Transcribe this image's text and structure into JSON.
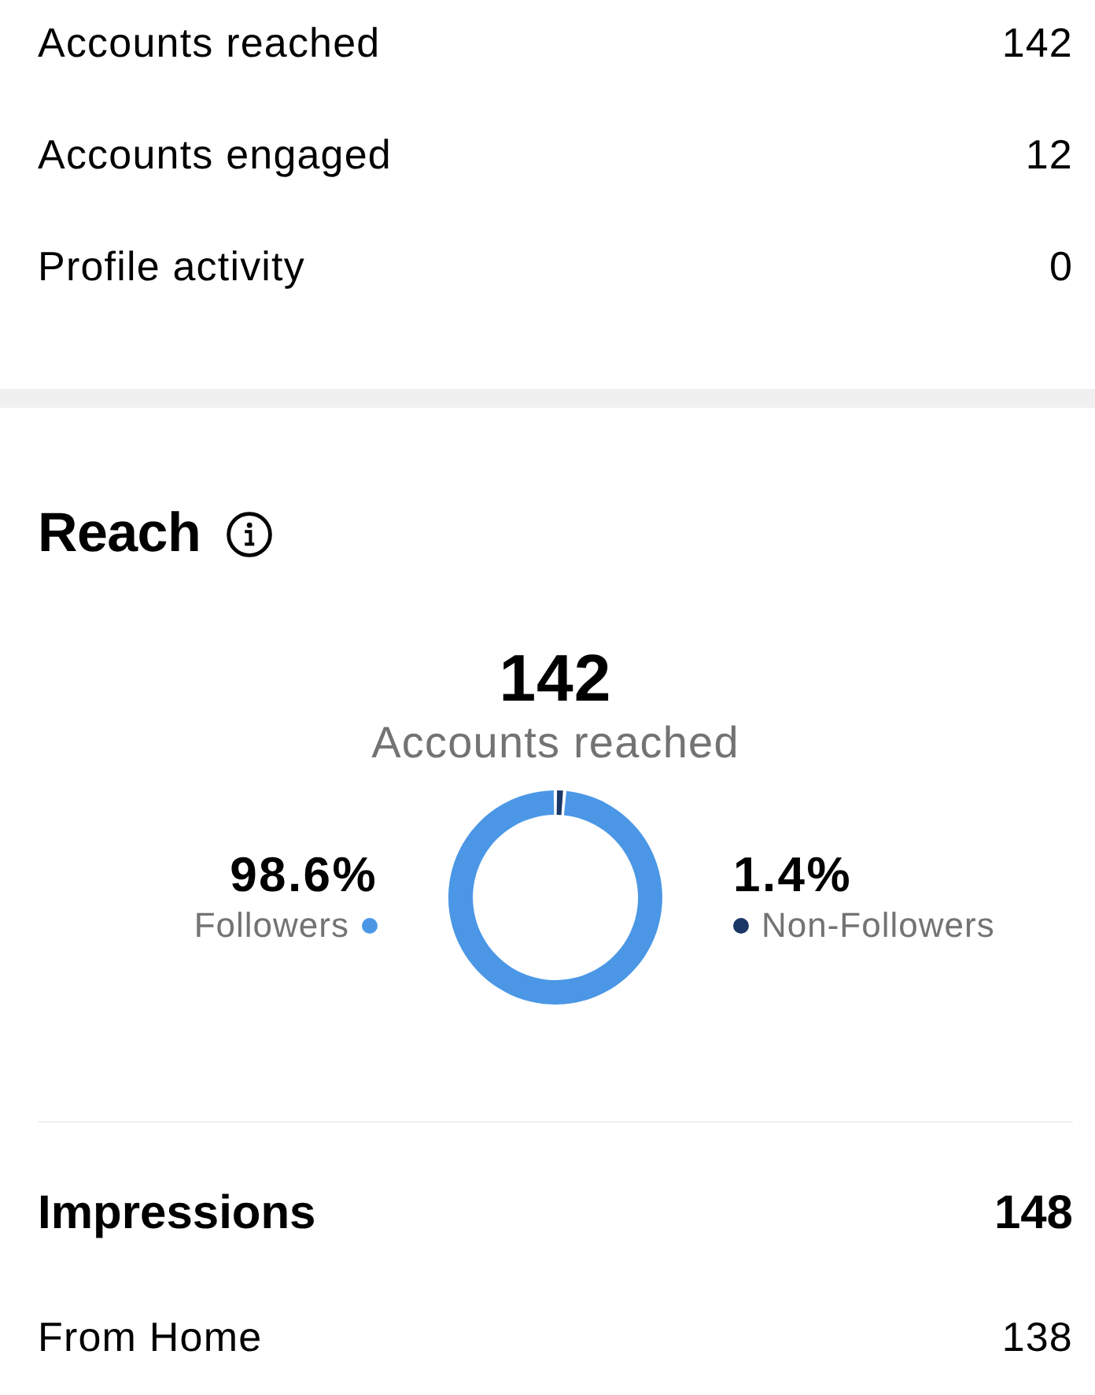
{
  "summary": {
    "rows": [
      {
        "label": "Accounts reached",
        "value": "142"
      },
      {
        "label": "Accounts engaged",
        "value": "12"
      },
      {
        "label": "Profile activity",
        "value": "0"
      }
    ]
  },
  "reach": {
    "title": "Reach",
    "total": "142",
    "total_label": "Accounts reached",
    "legend": [
      {
        "percent": "98.6%",
        "color": "#4b97e6"
      },
      {
        "percent": "1.4%",
        "color": "#1b3766"
      }
    ],
    "chart_data": {
      "type": "donut",
      "categories": [
        "Followers",
        "Non-Followers"
      ],
      "values": [
        98.6,
        1.4
      ]
    }
  },
  "impressions": {
    "title": "Impressions",
    "value": "148",
    "rows": [
      {
        "label": "From Home",
        "value": "138"
      }
    ]
  }
}
